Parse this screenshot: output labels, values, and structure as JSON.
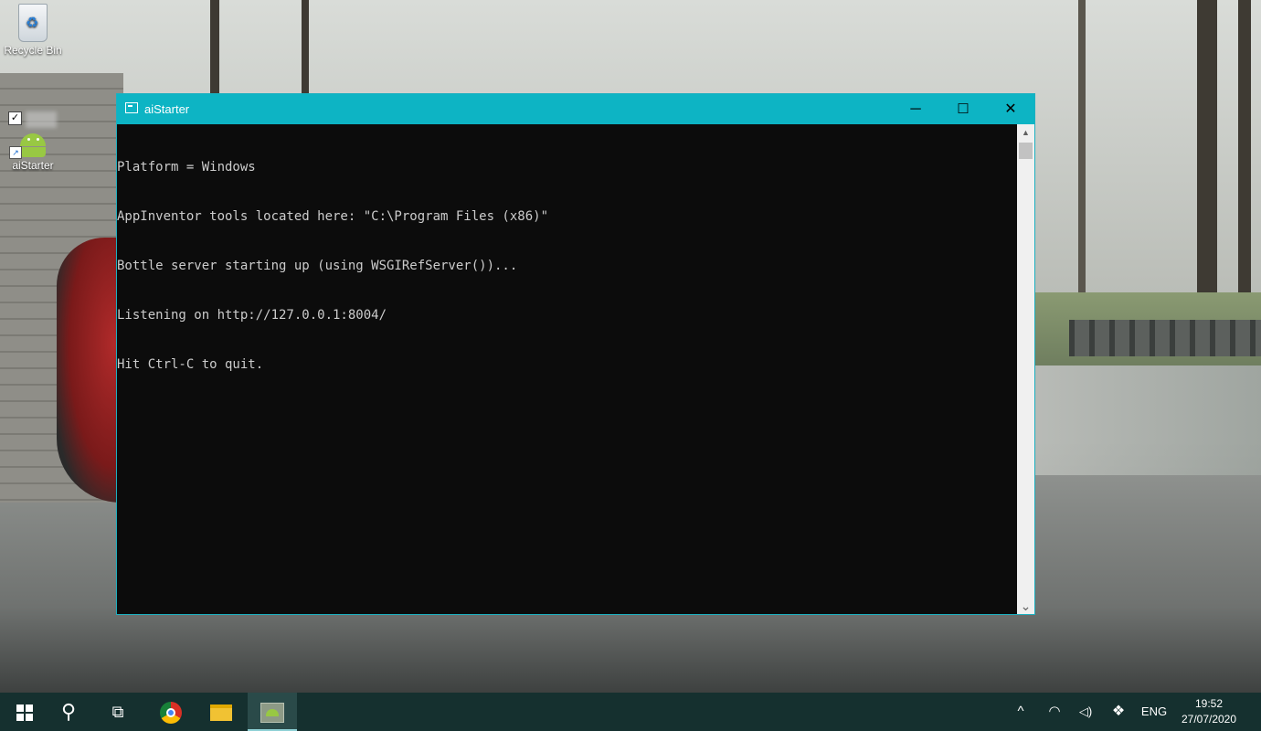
{
  "desktop": {
    "icons": [
      {
        "label": "Recycle Bin"
      },
      {
        "label": "aiStarter"
      }
    ]
  },
  "window": {
    "title": "aiStarter",
    "controls": {
      "minimize": "─",
      "maximize": "☐",
      "close": "✕"
    },
    "console_lines": [
      "Platform = Windows",
      "AppInventor tools located here: \"C:\\Program Files (x86)\"",
      "Bottle server starting up (using WSGIRefServer())...",
      "Listening on http://127.0.0.1:8004/",
      "Hit Ctrl-C to quit."
    ],
    "scroll": {
      "up": "▲",
      "down": "⌄"
    }
  },
  "taskbar": {
    "search_glyph": "⚲",
    "task_view_glyph": "⧉",
    "tray": {
      "chevron": "^",
      "network": "◠",
      "volume": "◁)",
      "dropbox": "❖",
      "language": "ENG"
    },
    "clock": {
      "time": "19:52",
      "date": "27/07/2020"
    }
  }
}
